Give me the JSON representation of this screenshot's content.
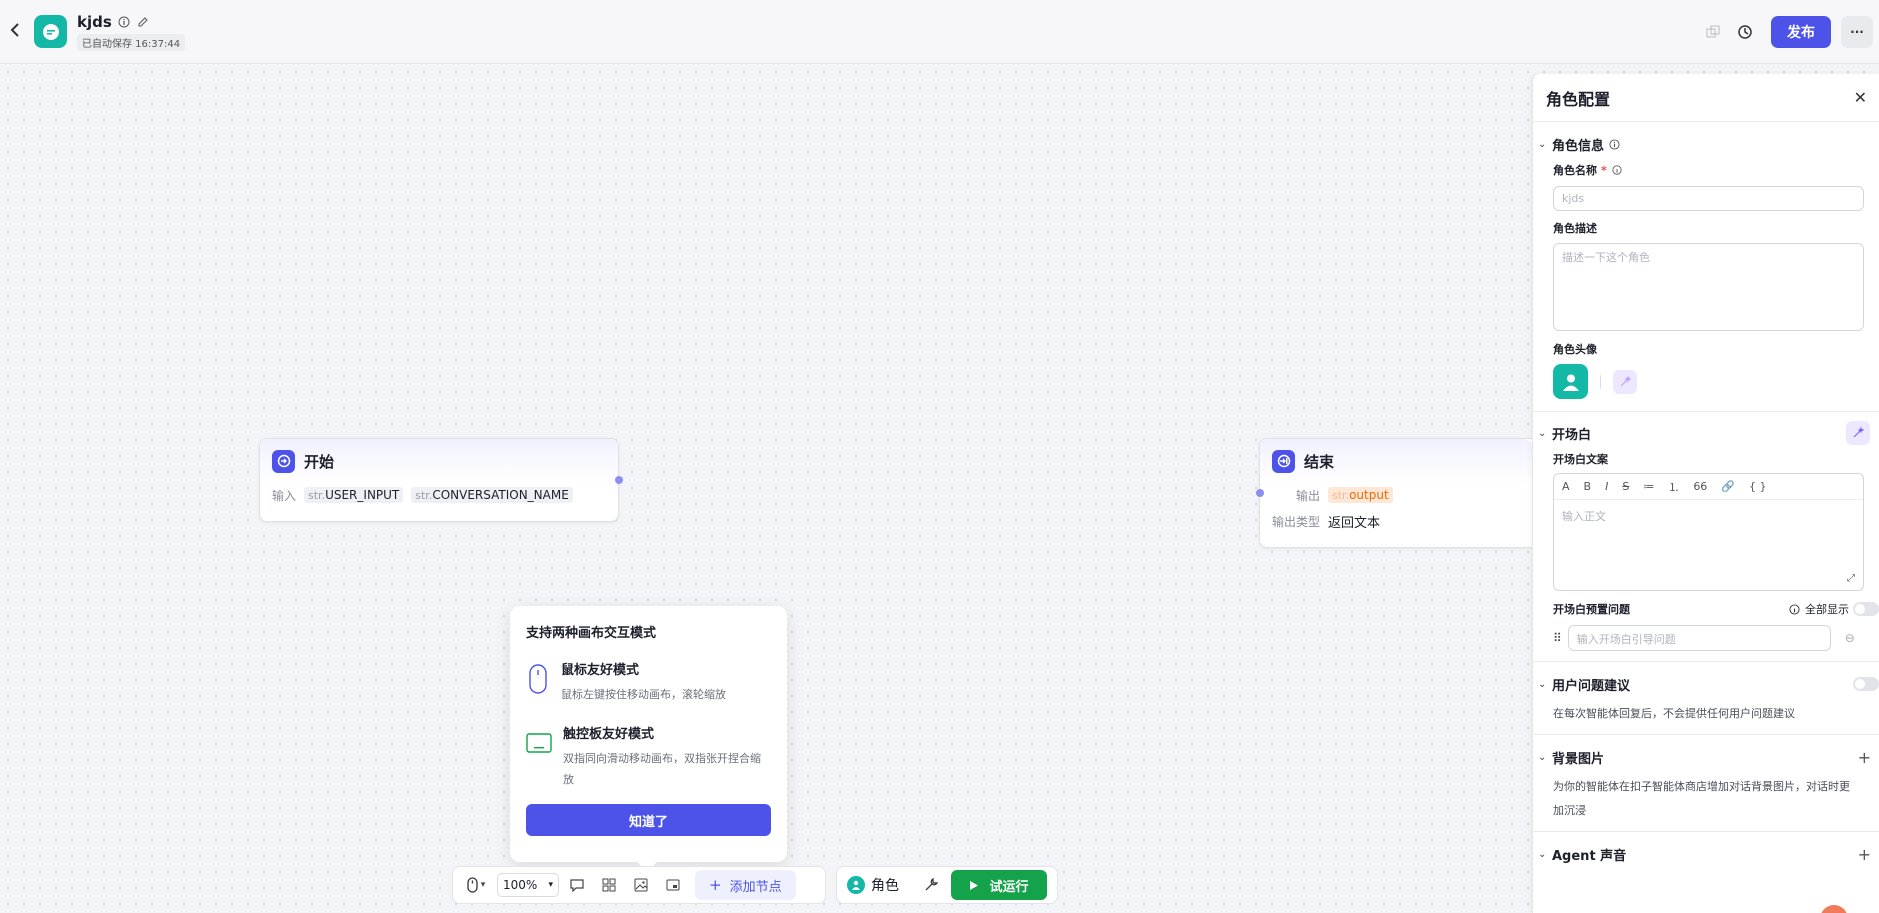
{
  "header": {
    "back_icon": "chevron-left-icon",
    "app_title": "kjds",
    "autosave": "已自动保存 16:37:44",
    "publish_label": "发布",
    "more_label": "···",
    "colors": {
      "brand": "#4d53e8",
      "app_icon": "#14b8a6"
    }
  },
  "canvas": {
    "start_node": {
      "title": "开始",
      "input_label": "输入",
      "vars": [
        {
          "type": "str.",
          "name": "USER_INPUT"
        },
        {
          "type": "str.",
          "name": "CONVERSATION_NAME"
        }
      ]
    },
    "end_node": {
      "title": "结束",
      "output_label": "输出",
      "output_var": {
        "type": "str.",
        "name": "output"
      },
      "output_type_label": "输出类型",
      "output_type_value": "返回文本"
    }
  },
  "popup": {
    "title": "支持两种画布交互模式",
    "modes": [
      {
        "name": "鼠标友好模式",
        "desc": "鼠标左键按住移动画布，滚轮缩放"
      },
      {
        "name": "触控板友好模式",
        "desc": "双指同向滑动移动画布，双指张开捏合缩放"
      }
    ],
    "confirm_label": "知道了"
  },
  "toolbar": {
    "zoom": "100%",
    "add_node_label": "添加节点",
    "role_label": "角色",
    "run_label": "试运行",
    "run_color": "#14a34a"
  },
  "panel": {
    "title": "角色配置",
    "role_info": {
      "title": "角色信息",
      "name_label": "角色名称",
      "name_placeholder": "kjds",
      "desc_label": "角色描述",
      "desc_placeholder": "描述一下这个角色",
      "avatar_label": "角色头像"
    },
    "opening": {
      "title": "开场白",
      "text_label": "开场白文案",
      "editor_placeholder": "输入正文",
      "toolbar_items": [
        "A",
        "B",
        "I",
        "S",
        "≔",
        "⒈",
        "66",
        "🔗",
        "{ }"
      ],
      "preset_label": "开场白预置问题",
      "show_all_label": "全部显示",
      "question_placeholder": "输入开场白引导问题"
    },
    "suggest": {
      "title": "用户问题建议",
      "desc": "在每次智能体回复后，不会提供任何用户问题建议"
    },
    "background": {
      "title": "背景图片",
      "desc": "为你的智能体在扣子智能体商店增加对话背景图片，对话时更加沉浸"
    },
    "voice": {
      "title": "Agent 声音"
    }
  }
}
